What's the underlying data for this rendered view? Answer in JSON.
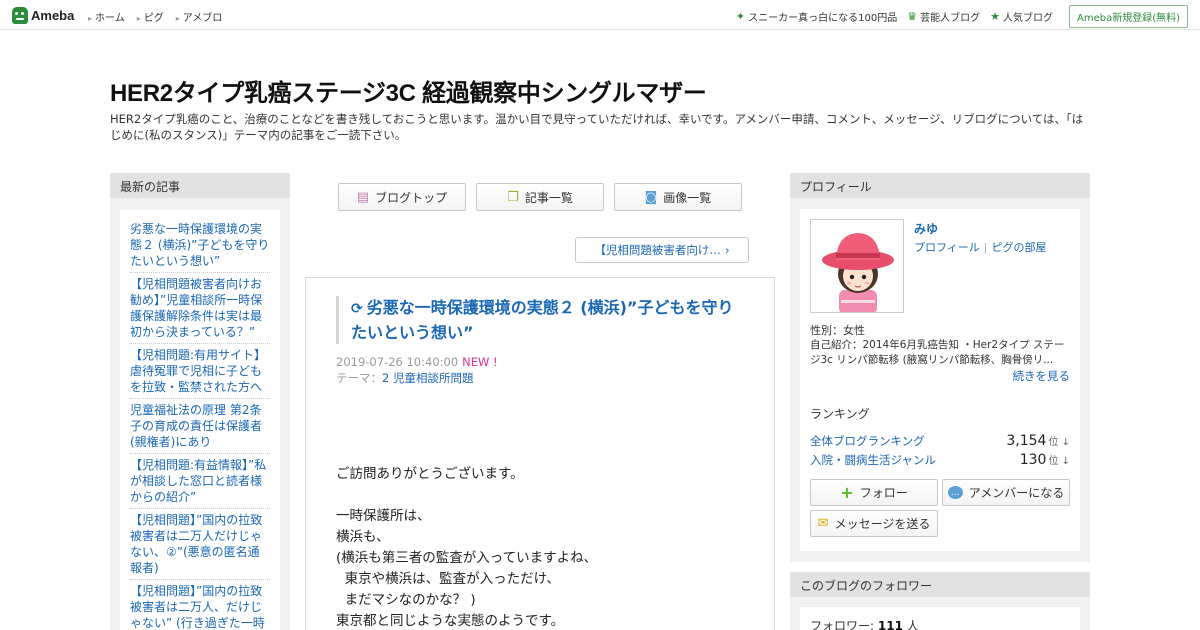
{
  "topbar": {
    "logo": "Ameba",
    "nav": [
      "ホーム",
      "ピグ",
      "アメブロ"
    ],
    "right_links": [
      {
        "icon": "sparkle-icon",
        "label": "スニーカー真っ白になる100円品"
      },
      {
        "icon": "crown-icon",
        "label": "芸能人ブログ"
      },
      {
        "icon": "star-icon",
        "label": "人気ブログ"
      }
    ],
    "register": "Ameba新規登録(無料)"
  },
  "header": {
    "title": "HER2タイプ乳癌ステージ3C 経過観察中シングルマザー",
    "description": "HER2タイプ乳癌のこと、治療のことなどを書き残しておこうと思います。温かい目で見守っていただければ、幸いです。アメンバー申請、コメント、メッセージ、リブログについては、「はじめに(私のスタンス)」テーマ内の記事をご一読下さい。"
  },
  "left": {
    "heading": "最新の記事",
    "items": [
      "劣悪な一時保護環境の実態２ (横浜)”子どもを守りたいという想い”",
      "【児相問題被害者向けお勧め】”児童相談所一時保護保護解除条件は実は最初から決まっている？”",
      "【児相問題:有用サイト】虐待冤罪で児相に子どもを拉致・監禁された方へ",
      "児童福祉法の原理 第2条 子の育成の責任は保護者(親権者)にあり",
      "【児相問題:有益情報】”私が相談した窓口と読者様からの紹介”",
      "【児相問題】”国内の拉致被害者は二万人だけじゃない、②”(悪意の匿名通報者)",
      "【児相問題】”国内の拉致被害者は二万人、だけじゃない” (行き過ぎた一時"
    ]
  },
  "tabs": [
    {
      "icon": "blog-top-icon",
      "label": "ブログトップ"
    },
    {
      "icon": "article-list-icon",
      "label": "記事一覧"
    },
    {
      "icon": "camera-icon",
      "label": "画像一覧"
    }
  ],
  "next_link": "【児相問題被害者向け…",
  "article": {
    "title": "劣悪な一時保護環境の実態２ (横浜)”子どもを守りたいという想い”",
    "date": "2019-07-26 10:40:00",
    "new": "NEW !",
    "theme_label": "テーマ：",
    "theme": "2 児童相談所問題",
    "body": "ご訪問ありがとうございます。\n\n一時保護所は、\n横浜も、\n(横浜も第三者の監査が入っていますよね、\n  東京や横浜は、監査が入っただけ、\n  まだマシなのかな？ )\n東京都と同じような実態のようです。"
  },
  "profile": {
    "heading": "プロフィール",
    "name": "みゆ",
    "link_profile": "プロフィール",
    "link_pig": "ピグの部屋",
    "gender": "性別：女性",
    "intro": "自己紹介：2014年6月乳癌告知 ・Her2タイプ ステージ3c リンパ節転移 (腋窩リンパ節転移、胸骨傍リ...",
    "more": "続きを見る",
    "ranking_heading": "ランキング",
    "rankings": [
      {
        "label": "全体ブログランキング",
        "value": "3,154",
        "unit": "位 ↓"
      },
      {
        "label": "入院・闘病生活ジャンル",
        "value": "130",
        "unit": "位 ↓"
      }
    ],
    "buttons": {
      "follow": "フォロー",
      "amember": "アメンバーになる",
      "message": "メッセージを送る"
    }
  },
  "followers": {
    "heading": "このブログのフォロワー",
    "label": "フォロワー:",
    "count": "111",
    "unit": "人"
  },
  "colors": {
    "ameba_green": "#2d8c3c",
    "link_blue": "#1a67b3",
    "new_pink": "#e0338a"
  }
}
